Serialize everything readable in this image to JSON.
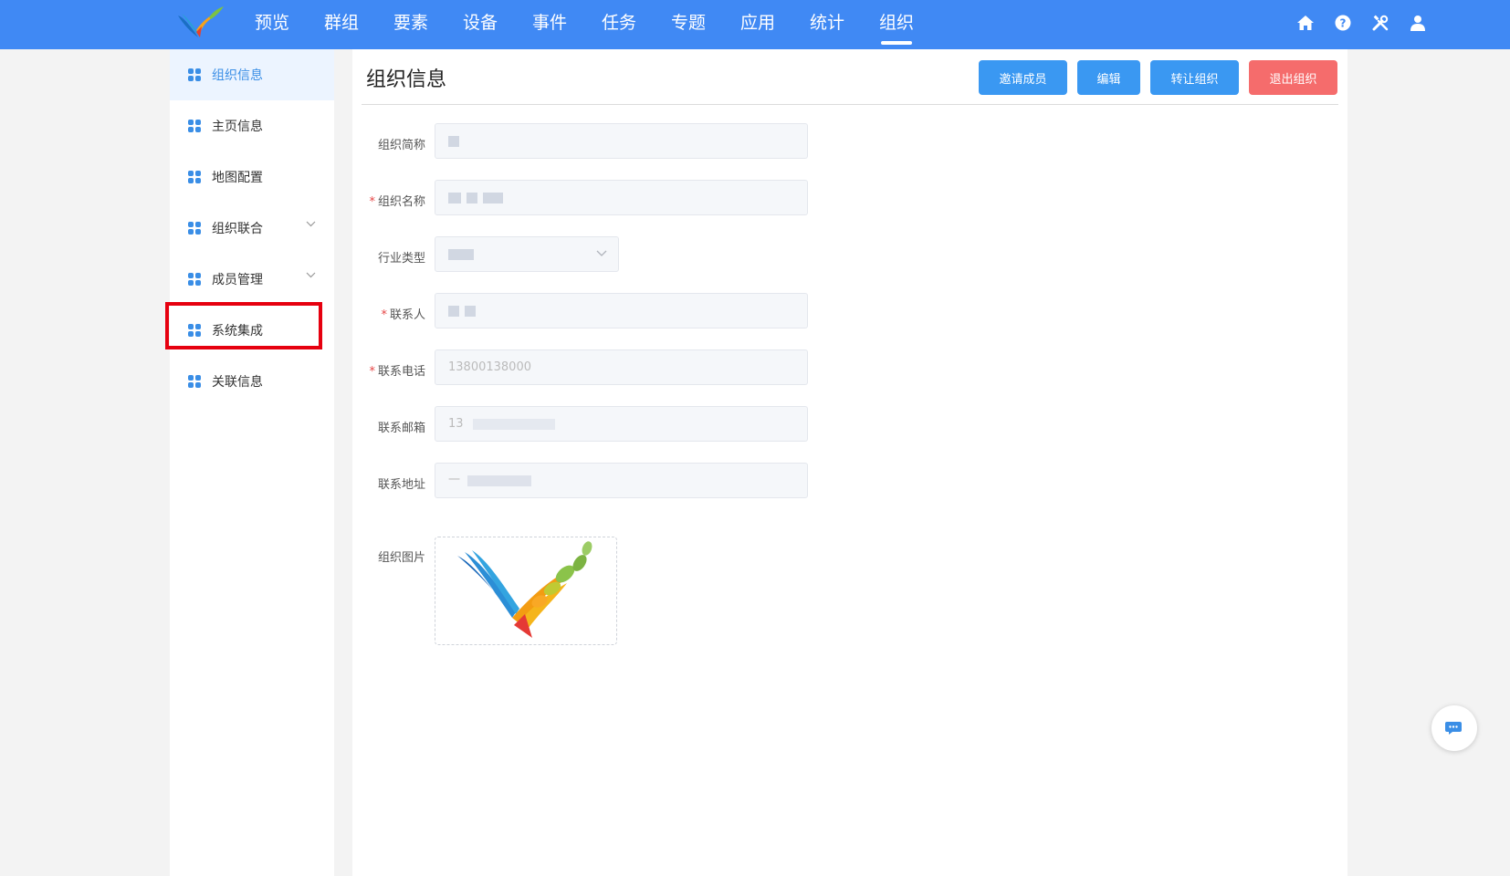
{
  "nav": {
    "items": [
      "预览",
      "群组",
      "要素",
      "设备",
      "事件",
      "任务",
      "专题",
      "应用",
      "统计",
      "组织"
    ],
    "active_index": 9,
    "icons": [
      "home-icon",
      "help-icon",
      "tools-icon",
      "user-icon"
    ]
  },
  "sidebar": {
    "items": [
      {
        "label": "组织信息",
        "active": true
      },
      {
        "label": "主页信息"
      },
      {
        "label": "地图配置"
      },
      {
        "label": "组织联合",
        "expandable": true
      },
      {
        "label": "成员管理",
        "expandable": true
      },
      {
        "label": "系统集成",
        "highlighted": true
      },
      {
        "label": "关联信息"
      }
    ]
  },
  "page": {
    "title": "组织信息",
    "buttons": {
      "invite": "邀请成员",
      "edit": "编辑",
      "transfer": "转让组织",
      "exit": "退出组织"
    }
  },
  "form": {
    "short_name_label": "组织简称",
    "full_name_label": "组织名称",
    "industry_label": "行业类型",
    "contact_label": "联系人",
    "phone_label": "联系电话",
    "phone_value": "13800138000",
    "email_label": "联系邮箱",
    "email_value": "13",
    "address_label": "联系地址",
    "address_value": "一",
    "image_label": "组织图片",
    "required_mark": "*"
  },
  "colors": {
    "header": "#4089f4",
    "primary_button": "#3a98f2",
    "danger_button": "#f56c6c",
    "highlight_box": "#e6000f"
  }
}
